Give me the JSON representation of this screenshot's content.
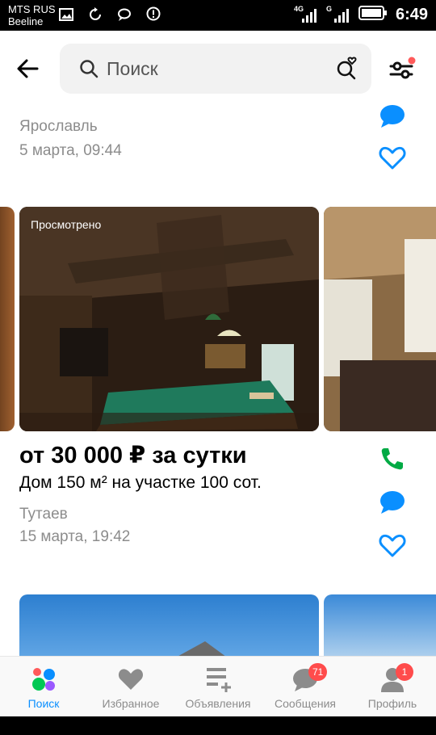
{
  "status_bar": {
    "carrier_1": "MTS RUS",
    "carrier_2": "Beeline",
    "network_1": "4G",
    "network_2": "G",
    "time": "6:49"
  },
  "search": {
    "placeholder": "Поиск"
  },
  "listings": [
    {
      "city": "Ярославль",
      "date": "5 марта, 09:44"
    },
    {
      "viewed_label": "Просмотрено",
      "price": "от 30 000 ₽ за сутки",
      "title": "Дом 150 м² на участке 100 сот.",
      "city": "Тутаев",
      "date": "15 марта, 19:42"
    }
  ],
  "tabbar": {
    "tabs": [
      {
        "label": "Поиск",
        "icon": "search-dots-icon",
        "active": true
      },
      {
        "label": "Избранное",
        "icon": "heart-icon"
      },
      {
        "label": "Объявления",
        "icon": "listings-add-icon"
      },
      {
        "label": "Сообщения",
        "icon": "chat-icon",
        "badge": "71"
      },
      {
        "label": "Профиль",
        "icon": "profile-icon",
        "badge": "1"
      }
    ]
  },
  "colors": {
    "accent": "#0a8fff",
    "phone": "#00aa44",
    "badge": "#ff4c4c"
  }
}
